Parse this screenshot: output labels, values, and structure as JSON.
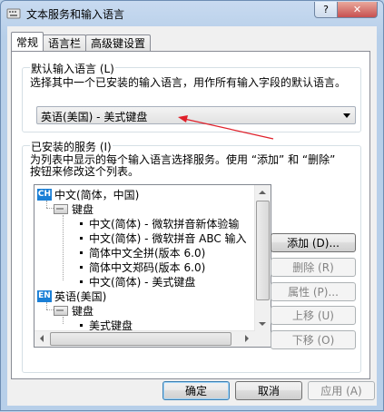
{
  "window": {
    "title": "文本服务和输入语言",
    "help_label": "?",
    "close_label": "✕"
  },
  "tabs": [
    {
      "label": "常规",
      "active": true
    },
    {
      "label": "语言栏",
      "active": false
    },
    {
      "label": "高级键设置",
      "active": false
    }
  ],
  "default_lang": {
    "title": "默认输入语言 (L)",
    "description": "选择其中一个已安装的输入语言，用作所有输入字段的默认语言。",
    "selected": "英语(美国) - 美式键盘"
  },
  "services": {
    "title": "已安装的服务 (I)",
    "description_line1": "为列表中显示的每个输入语言选择服务。使用 “添加” 和 “删除”",
    "description_line2": "按钮来修改这个列表。",
    "tree": {
      "lang1_code": "CH",
      "lang1_label": "中文(简体，中国)",
      "lang1_keyboard": "键盘",
      "lang1_items": [
        "中文(简体) - 微软拼音新体验输",
        "中文(简体) - 微软拼音 ABC 输入",
        "简体中文全拼(版本 6.0)",
        "简体中文郑码(版本 6.0)",
        "中文(简体) - 美式键盘"
      ],
      "lang2_code": "EN",
      "lang2_label": "英语(美国)",
      "lang2_keyboard": "键盘",
      "lang2_items": [
        "美式键盘"
      ]
    },
    "buttons": {
      "add": "添加 (D)...",
      "remove": "删除 (R)",
      "properties": "属性 (P)...",
      "move_up": "上移 (U)",
      "move_down": "下移 (O)"
    }
  },
  "footer": {
    "ok": "确定",
    "cancel": "取消",
    "apply": "应用 (A)"
  },
  "colors": {
    "annotation_arrow": "#e0202a",
    "lang_icon": "#1a7fd6"
  }
}
